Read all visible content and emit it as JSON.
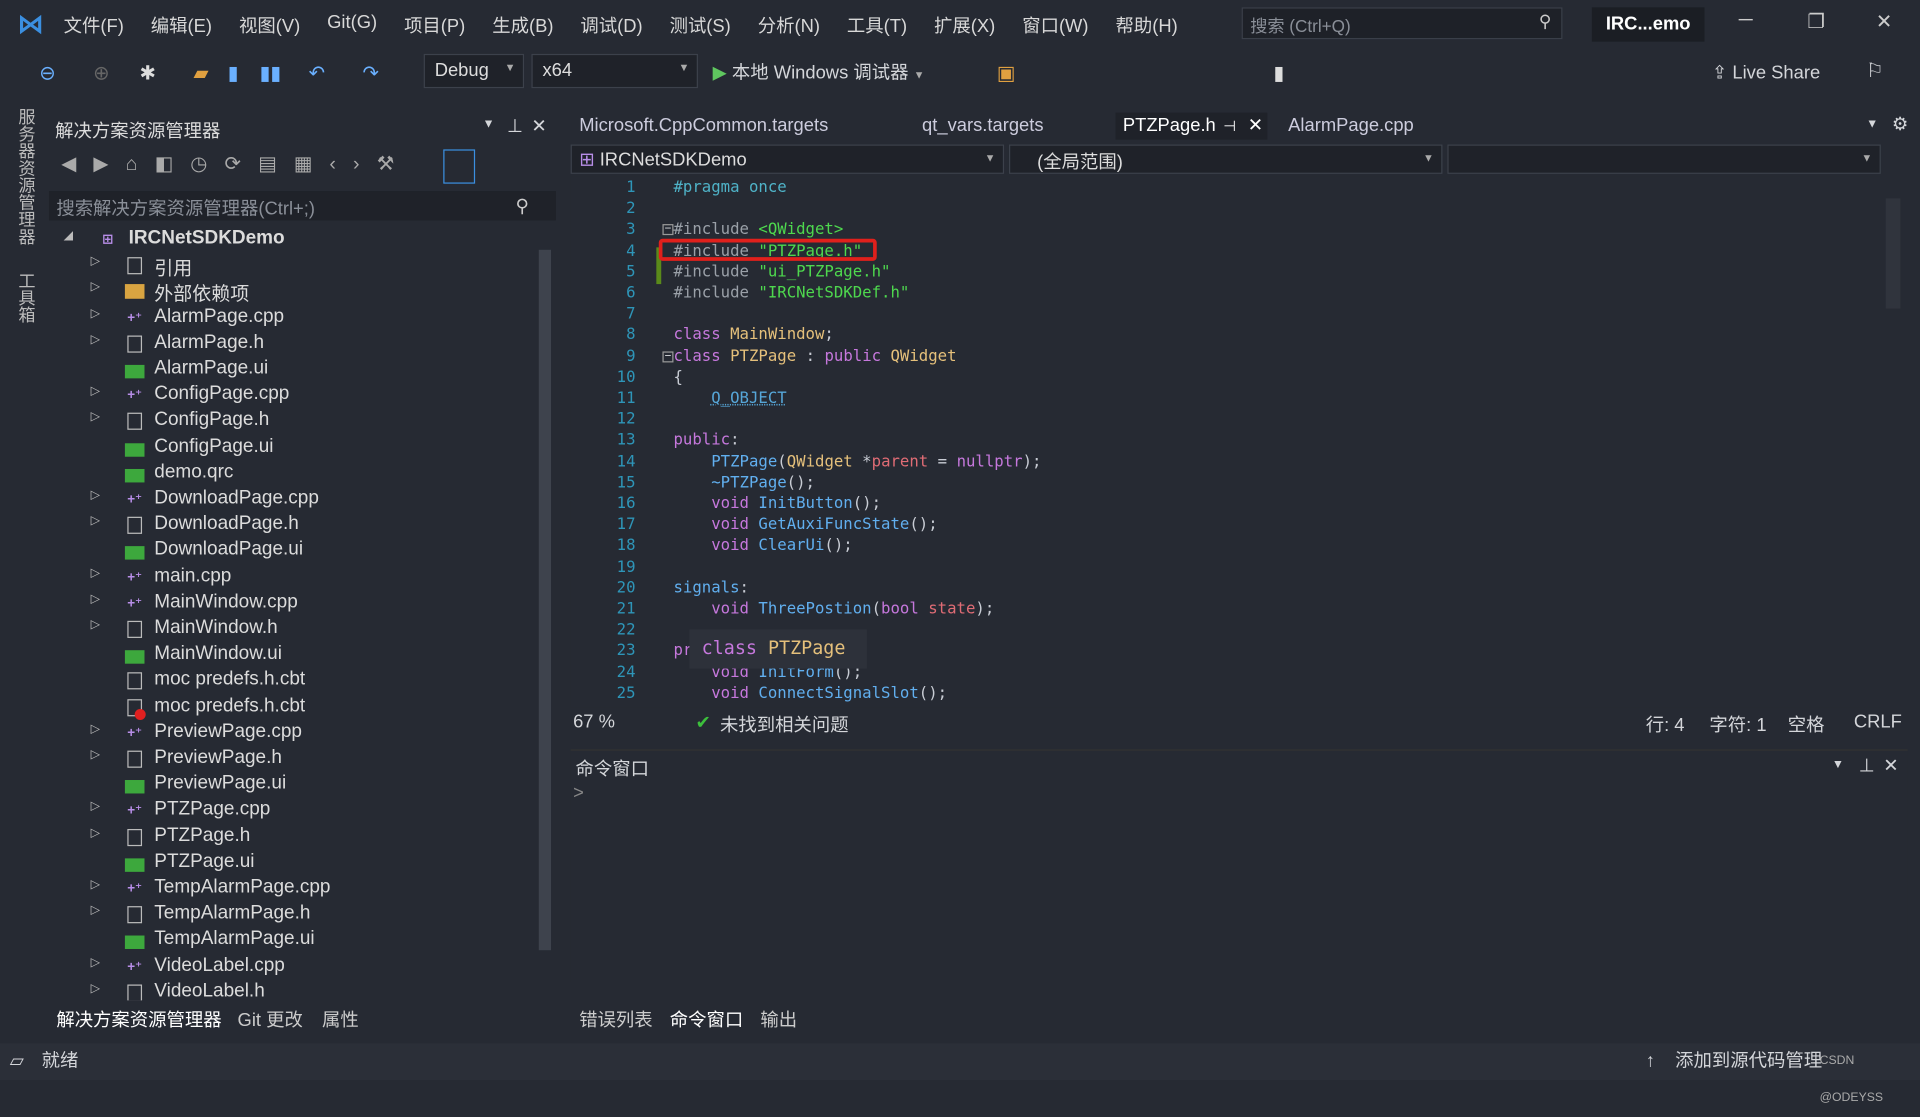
{
  "menu": {
    "items": [
      "文件(F)",
      "编辑(E)",
      "视图(V)",
      "Git(G)",
      "项目(P)",
      "生成(B)",
      "调试(D)",
      "测试(S)",
      "分析(N)",
      "工具(T)",
      "扩展(X)",
      "窗口(W)",
      "帮助(H)"
    ],
    "search_placeholder": "搜索 (Ctrl+Q)",
    "window_title": "IRC...emo"
  },
  "toolbar": {
    "config": "Debug",
    "platform": "x64",
    "run_label": "本地 Windows 调试器",
    "live_share": "Live Share"
  },
  "side_strip": {
    "server_explorer": "服务器资源管理器",
    "toolbox": "工具箱"
  },
  "solution_explorer": {
    "title": "解决方案资源管理器",
    "search_placeholder": "搜索解决方案资源管理器(Ctrl+;)",
    "root": "IRCNetSDKDemo",
    "items": [
      {
        "name": "引用",
        "icon": "references",
        "expander": true
      },
      {
        "name": "外部依赖项",
        "icon": "folder",
        "expander": true
      },
      {
        "name": "AlarmPage.cpp",
        "icon": "cpp",
        "expander": true
      },
      {
        "name": "AlarmPage.h",
        "icon": "h",
        "expander": true
      },
      {
        "name": "AlarmPage.ui",
        "icon": "ui",
        "expander": false
      },
      {
        "name": "ConfigPage.cpp",
        "icon": "cpp",
        "expander": true
      },
      {
        "name": "ConfigPage.h",
        "icon": "h",
        "expander": true
      },
      {
        "name": "ConfigPage.ui",
        "icon": "ui",
        "expander": false
      },
      {
        "name": "demo.qrc",
        "icon": "ui",
        "expander": false
      },
      {
        "name": "DownloadPage.cpp",
        "icon": "cpp",
        "expander": true
      },
      {
        "name": "DownloadPage.h",
        "icon": "h",
        "expander": true
      },
      {
        "name": "DownloadPage.ui",
        "icon": "ui",
        "expander": false
      },
      {
        "name": "main.cpp",
        "icon": "cpp",
        "expander": true
      },
      {
        "name": "MainWindow.cpp",
        "icon": "cpp",
        "expander": true
      },
      {
        "name": "MainWindow.h",
        "icon": "h",
        "expander": true
      },
      {
        "name": "MainWindow.ui",
        "icon": "ui",
        "expander": false
      },
      {
        "name": "moc predefs.h.cbt",
        "icon": "file",
        "expander": false
      },
      {
        "name": "moc predefs.h.cbt",
        "icon": "file-error",
        "expander": false
      },
      {
        "name": "PreviewPage.cpp",
        "icon": "cpp",
        "expander": true
      },
      {
        "name": "PreviewPage.h",
        "icon": "h",
        "expander": true
      },
      {
        "name": "PreviewPage.ui",
        "icon": "ui",
        "expander": false
      },
      {
        "name": "PTZPage.cpp",
        "icon": "cpp",
        "expander": true
      },
      {
        "name": "PTZPage.h",
        "icon": "h",
        "expander": true
      },
      {
        "name": "PTZPage.ui",
        "icon": "ui",
        "expander": false
      },
      {
        "name": "TempAlarmPage.cpp",
        "icon": "cpp",
        "expander": true
      },
      {
        "name": "TempAlarmPage.h",
        "icon": "h",
        "expander": true
      },
      {
        "name": "TempAlarmPage.ui",
        "icon": "ui",
        "expander": false
      },
      {
        "name": "VideoLabel.cpp",
        "icon": "cpp",
        "expander": true
      },
      {
        "name": "VideoLabel.h",
        "icon": "h",
        "expander": true
      }
    ],
    "bottom_tabs": [
      "解决方案资源管理器",
      "Git 更改",
      "属性"
    ]
  },
  "editor": {
    "tabs": [
      "Microsoft.CppCommon.targets",
      "qt_vars.targets",
      "PTZPage.h",
      "AlarmPage.cpp"
    ],
    "active_tab": 2,
    "nav_project": "IRCNetSDKDemo",
    "nav_scope": "(全局范围)",
    "lines": [
      [
        [
          "#pragma once",
          "pp2"
        ]
      ],
      [],
      [
        [
          "#include ",
          "pp"
        ],
        [
          "<QWidget>",
          "str"
        ]
      ],
      [
        [
          "#include ",
          "pp"
        ],
        [
          "\"PTZPage.h\"",
          "str"
        ]
      ],
      [
        [
          "#include ",
          "pp"
        ],
        [
          "\"ui_PTZPage.h\"",
          "str"
        ]
      ],
      [
        [
          "#include ",
          "pp"
        ],
        [
          "\"IRCNetSDKDef.h\"",
          "str"
        ]
      ],
      [],
      [
        [
          "class ",
          "kw"
        ],
        [
          "MainWindow",
          "ty"
        ],
        [
          ";",
          "pn"
        ]
      ],
      [
        [
          "class ",
          "kw"
        ],
        [
          "PTZPage",
          "ty"
        ],
        [
          " : ",
          "pn"
        ],
        [
          "public ",
          "kw"
        ],
        [
          "QWidget",
          "ty"
        ]
      ],
      [
        [
          "{",
          "pn"
        ]
      ],
      [
        [
          "    ",
          "pn"
        ],
        [
          "Q_OBJECT",
          "mac"
        ]
      ],
      [],
      [
        [
          "public",
          "kw"
        ],
        [
          ":",
          "pn"
        ]
      ],
      [
        [
          "    PTZPage",
          "fn"
        ],
        [
          "(",
          "pn"
        ],
        [
          "QWidget",
          "ty"
        ],
        [
          " *",
          "pn"
        ],
        [
          "parent",
          "par"
        ],
        [
          " = ",
          "pn"
        ],
        [
          "nullptr",
          "kw"
        ],
        [
          ");",
          "pn"
        ]
      ],
      [
        [
          "    ~PTZPage",
          "fn"
        ],
        [
          "();",
          "pn"
        ]
      ],
      [
        [
          "    void ",
          "kw"
        ],
        [
          "InitButton",
          "fn"
        ],
        [
          "();",
          "pn"
        ]
      ],
      [
        [
          "    void ",
          "kw"
        ],
        [
          "GetAuxiFuncState",
          "fn"
        ],
        [
          "();",
          "pn"
        ]
      ],
      [
        [
          "    void ",
          "kw"
        ],
        [
          "ClearUi",
          "fn"
        ],
        [
          "();",
          "pn"
        ]
      ],
      [],
      [
        [
          "signals",
          "fn"
        ],
        [
          ":",
          "pn"
        ]
      ],
      [
        [
          "    void ",
          "kw"
        ],
        [
          "ThreePostion",
          "fn"
        ],
        [
          "(",
          "pn"
        ],
        [
          "bool ",
          "kw"
        ],
        [
          "state",
          "par"
        ],
        [
          ");",
          "pn"
        ]
      ],
      [],
      [
        [
          "private",
          "kw"
        ],
        [
          ":",
          "pn"
        ]
      ],
      [
        [
          "    void ",
          "kw"
        ],
        [
          "InitForm",
          "fn"
        ],
        [
          "();",
          "pn"
        ]
      ],
      [
        [
          "    void ",
          "kw"
        ],
        [
          "ConnectSignalSlot",
          "fn"
        ],
        [
          "();",
          "pn"
        ]
      ]
    ],
    "tooltip": {
      "keyword": "class",
      "name": "PTZPage"
    },
    "zoom": "67 %",
    "issues": "未找到相关问题",
    "row": "行: 4",
    "col": "字符: 1",
    "ws": "空格",
    "eol": "CRLF"
  },
  "command_window": {
    "title": "命令窗口",
    "prompt": ">"
  },
  "bottom_tabs": [
    "错误列表",
    "命令窗口",
    "输出"
  ],
  "status": {
    "ready": "就绪",
    "source_control": "添加到源代码管理",
    "watermark": "CSDN @ODEYSS"
  }
}
